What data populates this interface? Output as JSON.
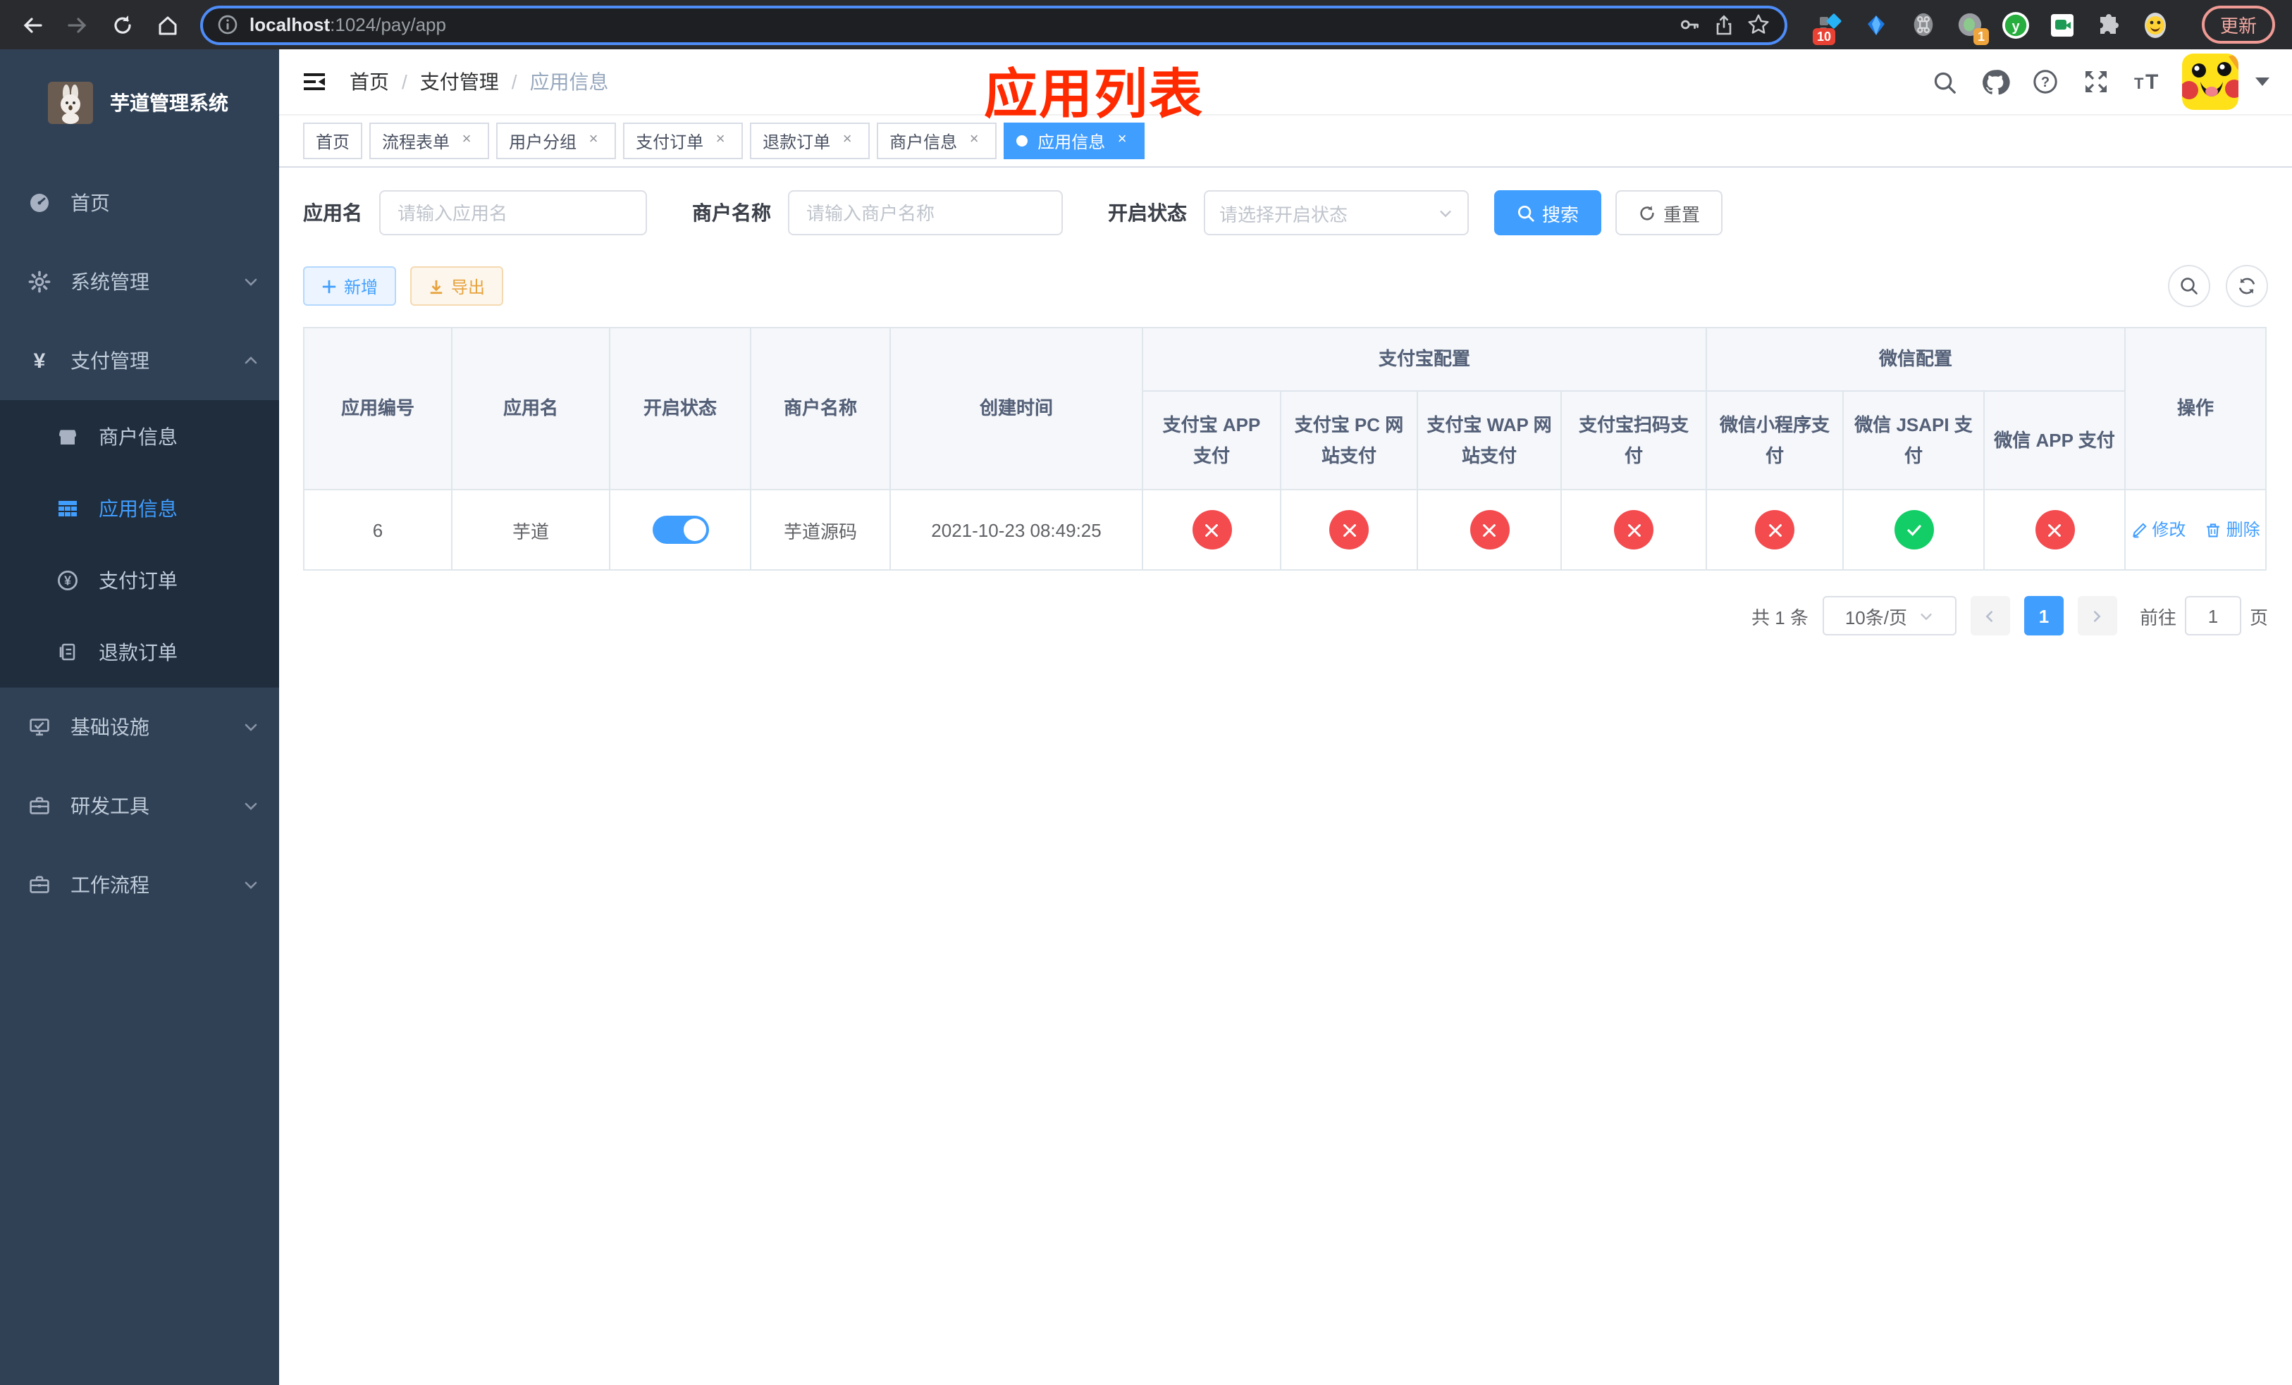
{
  "colors": {
    "accent": "#409eff",
    "success": "#13ce66",
    "danger": "#f44b4f",
    "warning": "#e6a23c",
    "annotation": "#ff2a00",
    "sidebar_bg": "#304156",
    "submenu_bg": "#1f2d3d",
    "header_bg": "#f5f7fa"
  },
  "browser": {
    "url_host": "localhost",
    "url_path": ":1024/pay/app",
    "update_label": "更新",
    "ext_badge_red": "10",
    "ext_badge_orange": "1"
  },
  "sidebar": {
    "title": "芋道管理系统",
    "items": [
      {
        "label": "首页",
        "icon": "dashboard-icon"
      },
      {
        "label": "系统管理",
        "icon": "gear-icon",
        "arrow": "down"
      },
      {
        "label": "支付管理",
        "icon": "yen-icon",
        "arrow": "up"
      },
      {
        "label": "商户信息",
        "icon": "shop-icon"
      },
      {
        "label": "应用信息",
        "icon": "grid-icon",
        "active": true
      },
      {
        "label": "支付订单",
        "icon": "yen-circle-icon"
      },
      {
        "label": "退款订单",
        "icon": "document-icon"
      },
      {
        "label": "基础设施",
        "icon": "monitor-icon",
        "arrow": "down"
      },
      {
        "label": "研发工具",
        "icon": "toolbox-icon",
        "arrow": "down"
      },
      {
        "label": "工作流程",
        "icon": "toolbox-icon",
        "arrow": "down"
      }
    ]
  },
  "navbar": {
    "breadcrumb": [
      "首页",
      "支付管理",
      "应用信息"
    ]
  },
  "annotation": {
    "text": "应用列表"
  },
  "tabs": {
    "items": [
      {
        "label": "首页",
        "closable": false,
        "active": false
      },
      {
        "label": "流程表单",
        "closable": true,
        "active": false
      },
      {
        "label": "用户分组",
        "closable": true,
        "active": false
      },
      {
        "label": "支付订单",
        "closable": true,
        "active": false
      },
      {
        "label": "退款订单",
        "closable": true,
        "active": false
      },
      {
        "label": "商户信息",
        "closable": true,
        "active": false
      },
      {
        "label": "应用信息",
        "closable": true,
        "active": true
      }
    ]
  },
  "filters": {
    "app_name": {
      "label": "应用名",
      "placeholder": "请输入应用名"
    },
    "merchant_name": {
      "label": "商户名称",
      "placeholder": "请输入商户名称"
    },
    "status": {
      "label": "开启状态",
      "placeholder": "请选择开启状态"
    },
    "search_label": "搜索",
    "reset_label": "重置"
  },
  "toolbar": {
    "add_label": "新增",
    "export_label": "导出"
  },
  "table": {
    "simple_columns": [
      "应用编号",
      "应用名",
      "开启状态",
      "商户名称",
      "创建时间"
    ],
    "groups": [
      {
        "label": "支付宝配置",
        "children": [
          "支付宝 APP 支付",
          "支付宝 PC 网站支付",
          "支付宝 WAP 网站支付",
          "支付宝扫码支付"
        ]
      },
      {
        "label": "微信配置",
        "children": [
          "微信小程序支付",
          "微信 JSAPI 支付",
          "微信 APP 支付"
        ]
      }
    ],
    "op_column": "操作",
    "row": {
      "id": "6",
      "name": "芋道",
      "enabled": true,
      "merchant": "芋道源码",
      "created": "2021-10-23 08:49:25",
      "statuses": [
        "error",
        "error",
        "error",
        "error",
        "error",
        "success",
        "error"
      ],
      "edit_label": "修改",
      "delete_label": "删除"
    }
  },
  "pagination": {
    "total": "共 1 条",
    "page_size": "10条/页",
    "current_page": "1",
    "goto_label": "前往",
    "goto_value": "1",
    "page_unit": "页"
  }
}
